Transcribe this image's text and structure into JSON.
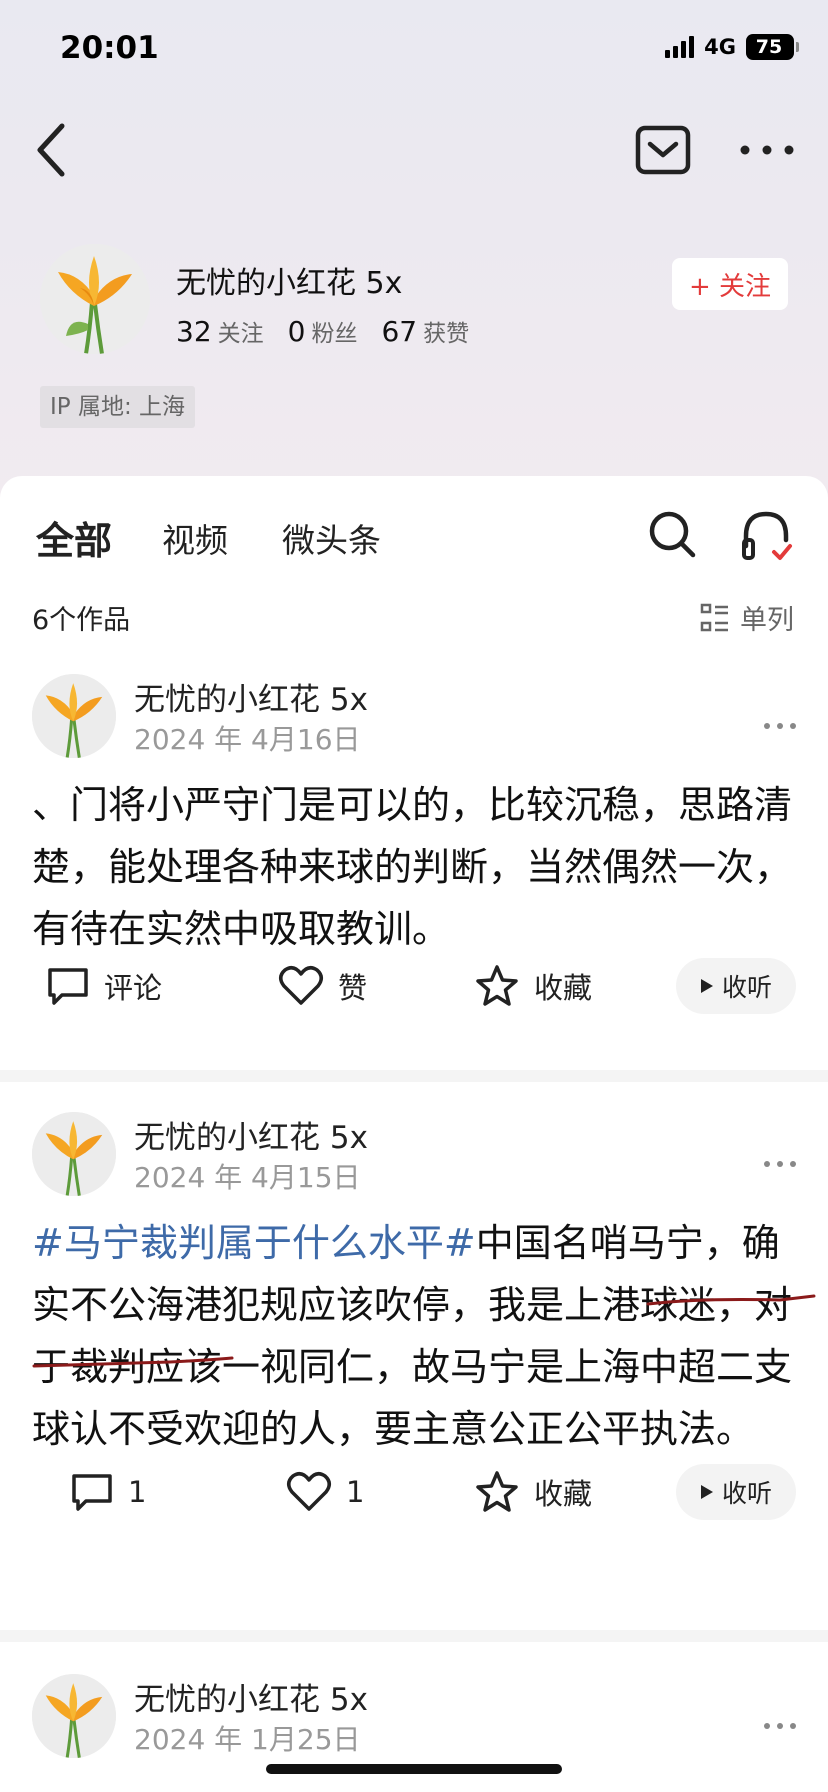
{
  "status_bar": {
    "time": "20:01",
    "network": "4G",
    "battery": "75",
    "battery_level": 0.75
  },
  "profile": {
    "name": "无忧的小红花 5x",
    "follow_label": "+ 关注",
    "following_count": "32",
    "following_label": "关注",
    "fans_count": "0",
    "fans_label": "粉丝",
    "likes_count": "67",
    "likes_label": "获赞",
    "ip_location": "IP 属地: 上海"
  },
  "tabs": [
    {
      "label": "全部",
      "active": true
    },
    {
      "label": "视频",
      "active": false
    },
    {
      "label": "微头条",
      "active": false
    }
  ],
  "works_count": "6个作品",
  "view_mode": "单列",
  "posts": [
    {
      "author": "无忧的小红花 5x",
      "date": "2024 年 4月16日",
      "text": "、门将小严守门是可以的，比较沉稳，思路清楚，能处理各种来球的判断，当然偶然一次，有待在实然中吸取教训。",
      "comment_label": "评论",
      "like_label": "赞",
      "collect_label": "收藏",
      "listen_label": "收听"
    },
    {
      "author": "无忧的小红花 5x",
      "date": "2024 年 4月15日",
      "hashtag": "#马宁裁判属于什么水平#",
      "text": "中国名哨马宁，确实不公海港犯规应该吹停，我是上港球迷，对于裁判应该一视同仁，故马宁是上海中超二支球认不受欢迎的人，要主意公正公平执法。",
      "comment_count": "1",
      "like_count": "1",
      "collect_label": "收藏",
      "listen_label": "收听"
    },
    {
      "author": "无忧的小红花 5x",
      "date": "2024 年 1月25日"
    }
  ],
  "colors": {
    "accent_red": "#e33b3b",
    "hashtag_blue": "#3e6aa8",
    "annotation_red": "#8b1a1a"
  }
}
